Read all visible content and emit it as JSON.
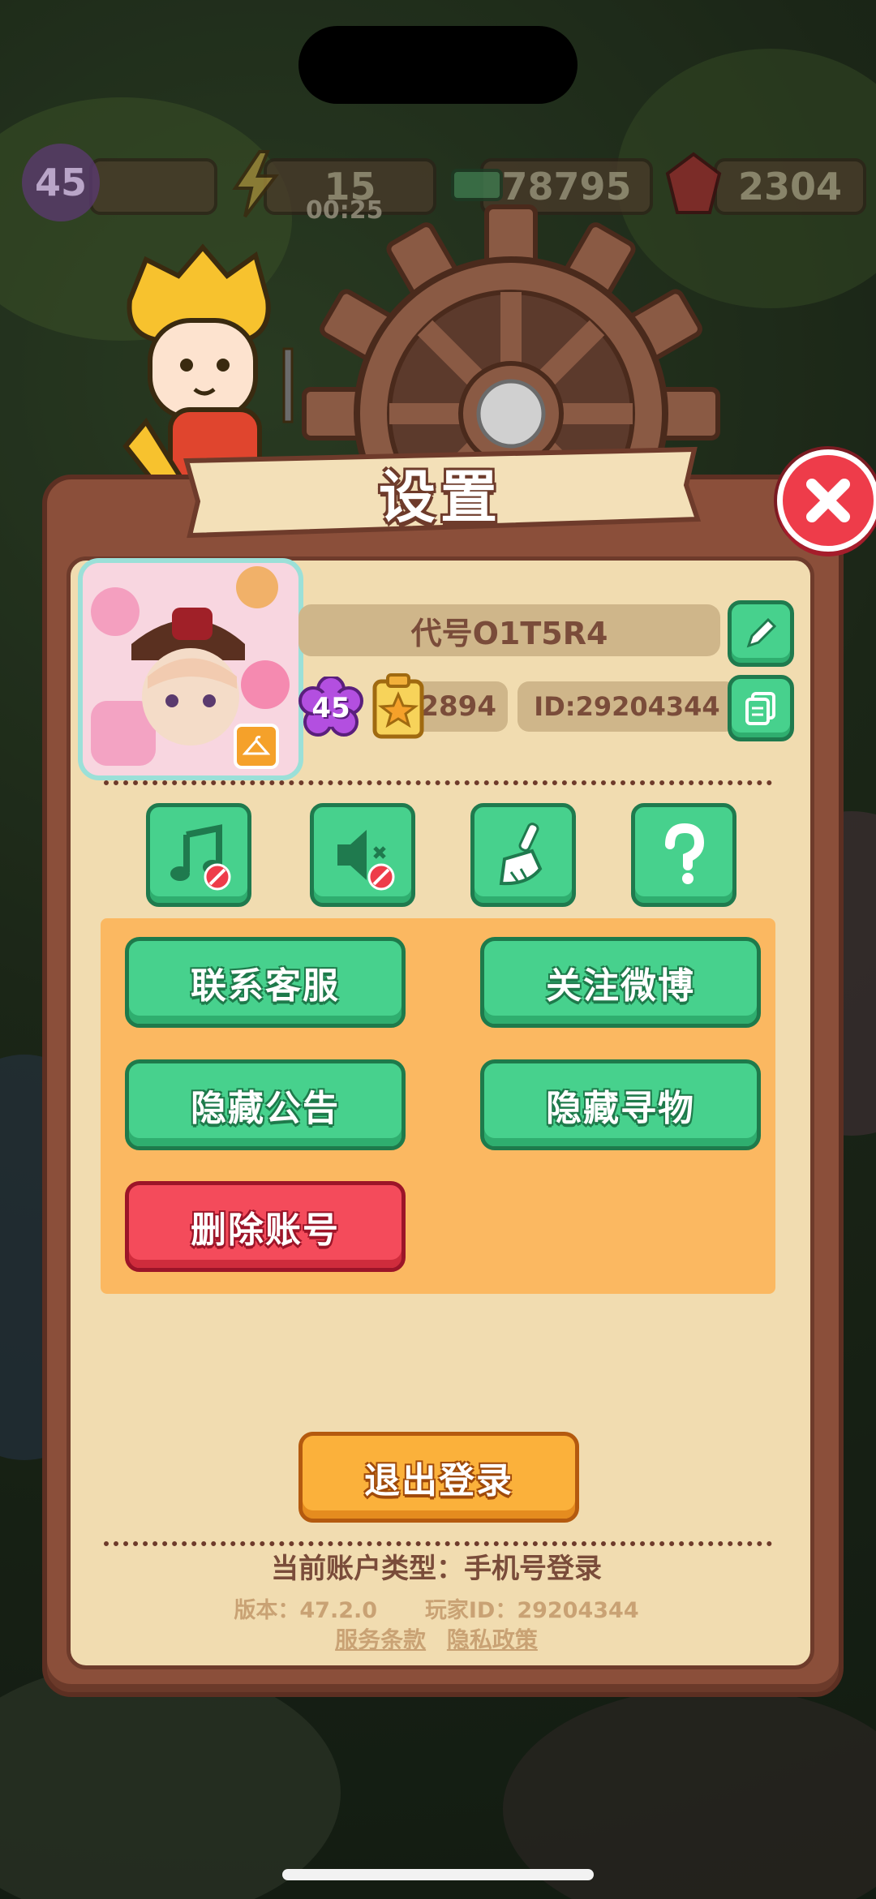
{
  "hud": {
    "level": "45",
    "energy": "15",
    "energy_timer": "00:25",
    "cash": "78795",
    "gems": "2304"
  },
  "settings": {
    "title": "设置",
    "player_name": "代号O1T5R4",
    "player_level": "45",
    "collection_count": "2894",
    "id_label": "ID:29204344"
  },
  "buttons": {
    "contact_support": "联系客服",
    "follow_weibo": "关注微博",
    "hide_announcement": "隐藏公告",
    "hide_search": "隐藏寻物",
    "delete_account": "删除账号",
    "logout": "退出登录"
  },
  "footer": {
    "account_type": "当前账户类型：手机号登录",
    "version": "版本：47.2.0",
    "player_id": "玩家ID：29204344",
    "terms": "服务条款",
    "privacy": "隐私政策"
  },
  "colors": {
    "green_button": "#47d18d",
    "red_button": "#f44b5b",
    "orange_button": "#fbb13b",
    "panel": "#f1dcb0",
    "frame": "#8b4f3a"
  }
}
